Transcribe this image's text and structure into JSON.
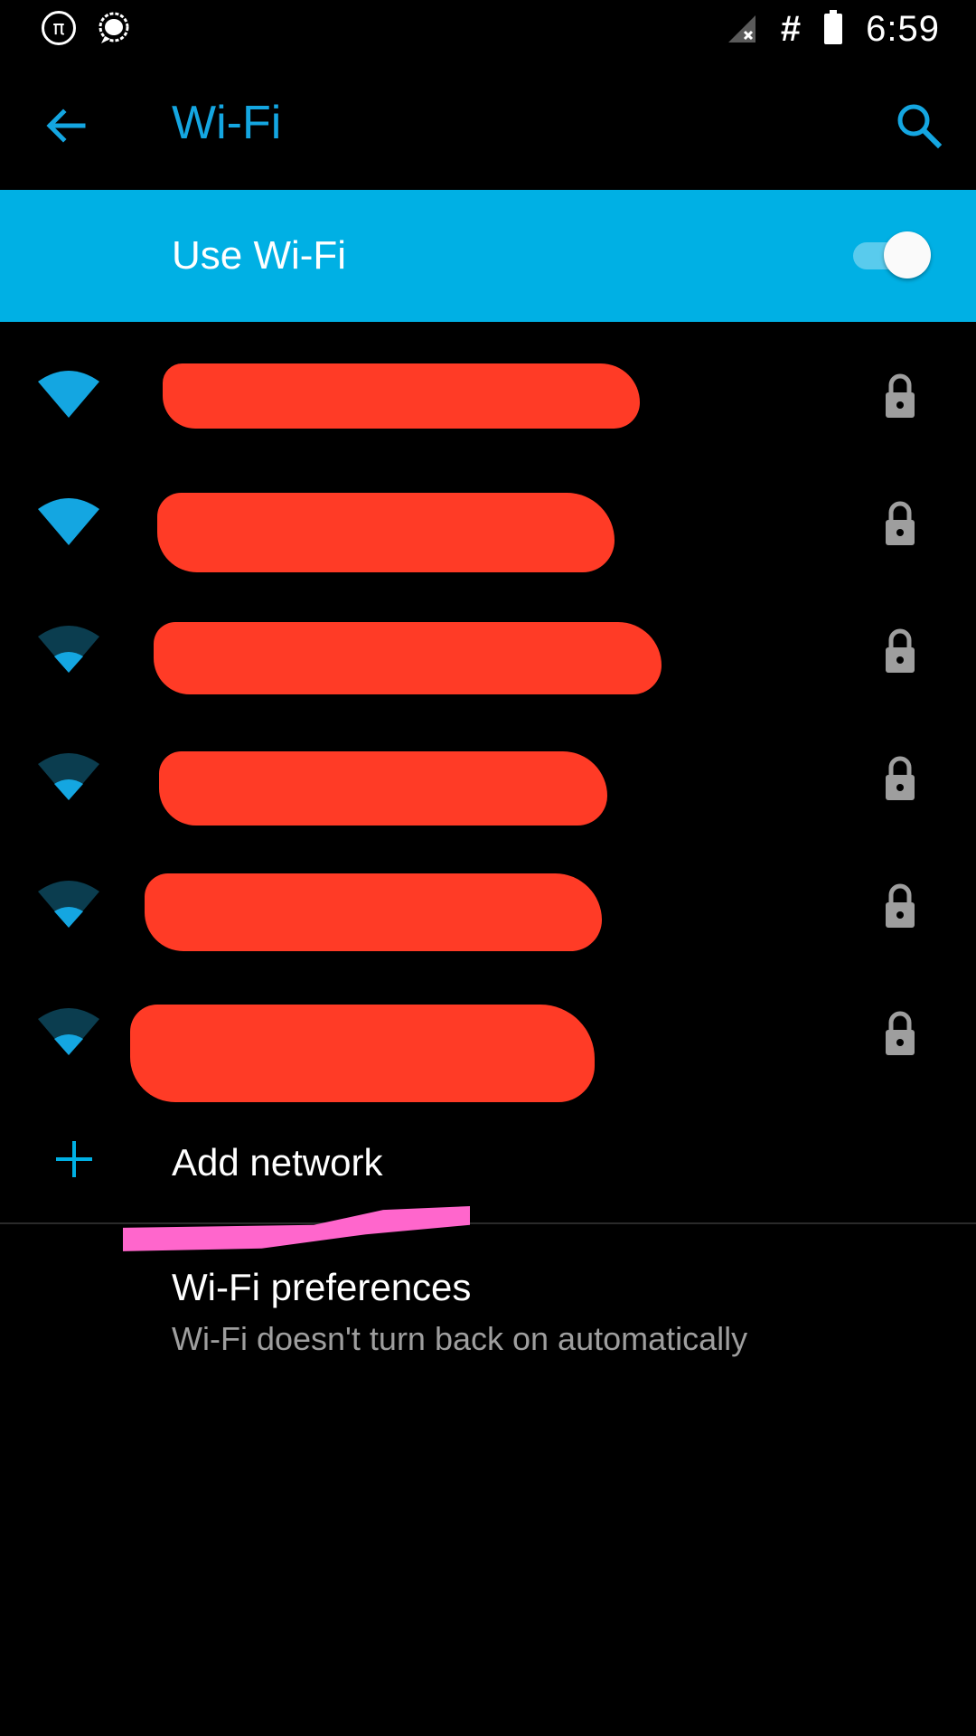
{
  "status_bar": {
    "pi_icon_glyph": "π",
    "hash_glyph": "#",
    "time": "6:59",
    "icons": [
      "pi-icon",
      "message-icon",
      "signal-off-icon",
      "hash-icon",
      "battery-icon"
    ]
  },
  "toolbar": {
    "title": "Wi-Fi",
    "back_icon": "arrow-back-icon",
    "search_icon": "search-icon"
  },
  "master_switch": {
    "label": "Use Wi-Fi",
    "state": "on"
  },
  "networks": [
    {
      "name": "",
      "signal": "full",
      "secured": true
    },
    {
      "name": "",
      "signal": "full",
      "secured": true
    },
    {
      "name": "",
      "signal": "weak",
      "secured": true
    },
    {
      "name": "",
      "signal": "weak",
      "secured": true
    },
    {
      "name": "",
      "signal": "weak",
      "secured": true
    },
    {
      "name": "",
      "signal": "weak",
      "secured": true
    }
  ],
  "add_network": {
    "label": "Add network"
  },
  "preferences": {
    "title": "Wi-Fi preferences",
    "subtitle": "Wi-Fi doesn't turn back on automatically"
  },
  "colors": {
    "accent": "#14a6e1",
    "header_bar": "#00b0e4",
    "redaction": "#ff3b26",
    "highlight_mark": "#ff66cc",
    "wifi_dim": "#0b3d4f"
  }
}
